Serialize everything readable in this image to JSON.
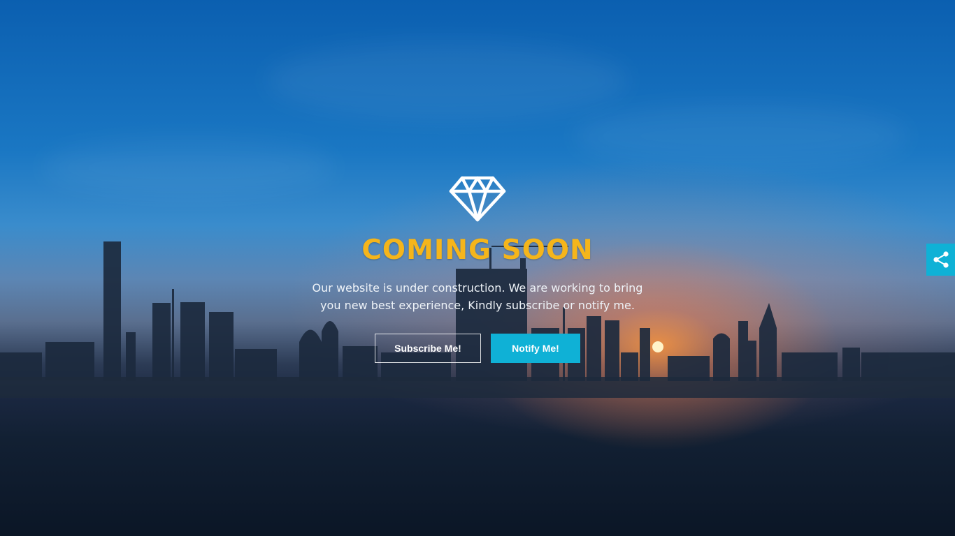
{
  "hero": {
    "logo_icon": "diamond-icon",
    "title": "COMING SOON",
    "description_line1": "Our website is under construction. We are working to bring",
    "description_line2": "you new best experience, Kindly subscribe or notify me."
  },
  "buttons": {
    "subscribe_label": "Subscribe Me!",
    "notify_label": "Notify Me!"
  },
  "share": {
    "icon": "share-icon"
  },
  "colors": {
    "accent_yellow": "#f5b51b",
    "accent_cyan": "#0fb1d6",
    "text_light": "#eef3f8"
  }
}
